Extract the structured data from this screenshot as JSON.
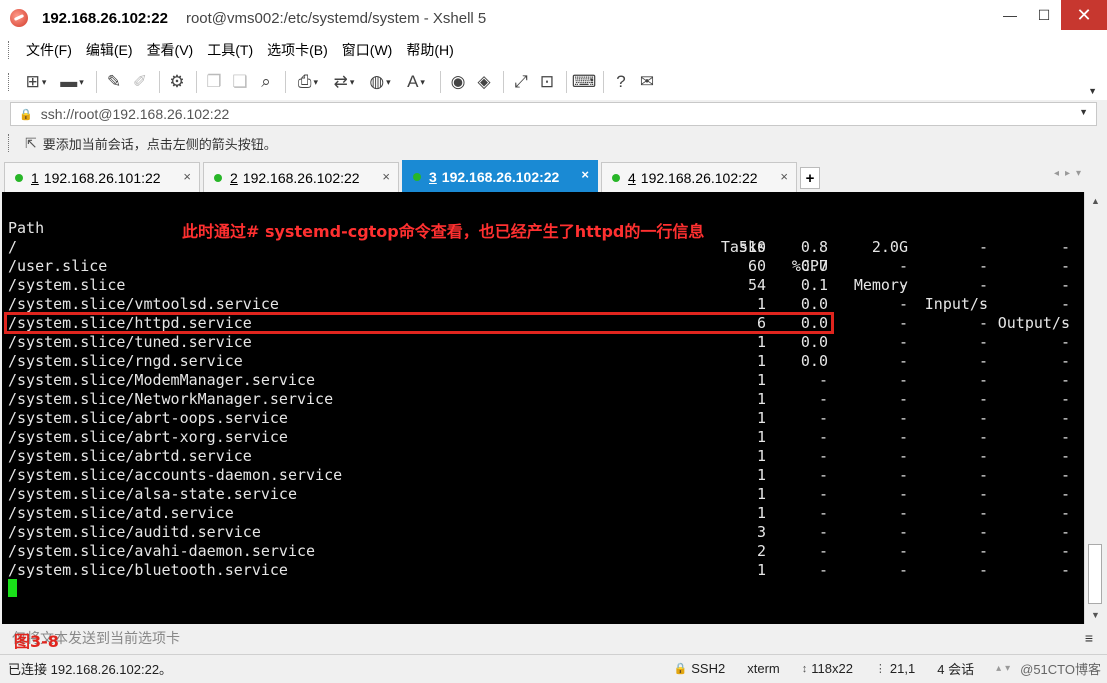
{
  "window": {
    "host_title": "192.168.26.102:22",
    "title_rest": "root@vms002:/etc/systemd/system - Xshell 5",
    "minimize_glyph": "—",
    "maximize_glyph": "☐",
    "close_glyph": "✕"
  },
  "menu": [
    "文件(F)",
    "编辑(E)",
    "查看(V)",
    "工具(T)",
    "选项卡(B)",
    "窗口(W)",
    "帮助(H)"
  ],
  "toolbar_icons": [
    "new-session-icon",
    "open-folder-icon",
    "edit-icon",
    "highlighter-icon",
    "properties-icon",
    "copy-icon",
    "paste-icon",
    "find-icon",
    "print-icon",
    "transfer-icon",
    "globe-icon",
    "font-icon",
    "xftp-icon",
    "xmanager-icon",
    "fullscreen-icon",
    "lock-icon",
    "keyboard-icon",
    "help-icon",
    "chat-icon"
  ],
  "address": {
    "value": "ssh://root@192.168.26.102:22"
  },
  "hint": {
    "text": "要添加当前会话，点击左侧的箭头按钮。"
  },
  "tabs": [
    {
      "num": "1",
      "label": "192.168.26.101:22",
      "active": false
    },
    {
      "num": "2",
      "label": "192.168.26.102:22",
      "active": false
    },
    {
      "num": "3",
      "label": "192.168.26.102:22",
      "active": true
    },
    {
      "num": "4",
      "label": "192.168.26.102:22",
      "active": false
    }
  ],
  "terminal": {
    "headers": {
      "path": "Path",
      "tasks": "Tasks",
      "cpu": "%CPU",
      "memory": "Memory",
      "input": "Input/s",
      "output": "Output/s"
    },
    "annotation": "此时通过# systemd-cgtop命令查看，也已经产生了httpd的一行信息",
    "rows": [
      {
        "path": "/",
        "tasks": "510",
        "cpu": "0.8",
        "memory": "2.0G",
        "input": "-",
        "output": "-"
      },
      {
        "path": "/user.slice",
        "tasks": "60",
        "cpu": "0.7",
        "memory": "-",
        "input": "-",
        "output": "-"
      },
      {
        "path": "/system.slice",
        "tasks": "54",
        "cpu": "0.1",
        "memory": "-",
        "input": "-",
        "output": "-"
      },
      {
        "path": "/system.slice/vmtoolsd.service",
        "tasks": "1",
        "cpu": "0.0",
        "memory": "-",
        "input": "-",
        "output": "-"
      },
      {
        "path": "/system.slice/httpd.service",
        "tasks": "6",
        "cpu": "0.0",
        "memory": "-",
        "input": "-",
        "output": "-"
      },
      {
        "path": "/system.slice/tuned.service",
        "tasks": "1",
        "cpu": "0.0",
        "memory": "-",
        "input": "-",
        "output": "-"
      },
      {
        "path": "/system.slice/rngd.service",
        "tasks": "1",
        "cpu": "0.0",
        "memory": "-",
        "input": "-",
        "output": "-"
      },
      {
        "path": "/system.slice/ModemManager.service",
        "tasks": "1",
        "cpu": "-",
        "memory": "-",
        "input": "-",
        "output": "-"
      },
      {
        "path": "/system.slice/NetworkManager.service",
        "tasks": "1",
        "cpu": "-",
        "memory": "-",
        "input": "-",
        "output": "-"
      },
      {
        "path": "/system.slice/abrt-oops.service",
        "tasks": "1",
        "cpu": "-",
        "memory": "-",
        "input": "-",
        "output": "-"
      },
      {
        "path": "/system.slice/abrt-xorg.service",
        "tasks": "1",
        "cpu": "-",
        "memory": "-",
        "input": "-",
        "output": "-"
      },
      {
        "path": "/system.slice/abrtd.service",
        "tasks": "1",
        "cpu": "-",
        "memory": "-",
        "input": "-",
        "output": "-"
      },
      {
        "path": "/system.slice/accounts-daemon.service",
        "tasks": "1",
        "cpu": "-",
        "memory": "-",
        "input": "-",
        "output": "-"
      },
      {
        "path": "/system.slice/alsa-state.service",
        "tasks": "1",
        "cpu": "-",
        "memory": "-",
        "input": "-",
        "output": "-"
      },
      {
        "path": "/system.slice/atd.service",
        "tasks": "1",
        "cpu": "-",
        "memory": "-",
        "input": "-",
        "output": "-"
      },
      {
        "path": "/system.slice/auditd.service",
        "tasks": "3",
        "cpu": "-",
        "memory": "-",
        "input": "-",
        "output": "-"
      },
      {
        "path": "/system.slice/avahi-daemon.service",
        "tasks": "2",
        "cpu": "-",
        "memory": "-",
        "input": "-",
        "output": "-"
      },
      {
        "path": "/system.slice/bluetooth.service",
        "tasks": "1",
        "cpu": "-",
        "memory": "-",
        "input": "-",
        "output": "-"
      }
    ]
  },
  "input_bar": {
    "placeholder": "仅将文本发送到当前选项卡",
    "figure_label": "图3-8"
  },
  "status": {
    "connection": "已连接 192.168.26.102:22。",
    "protocol": "SSH2",
    "terminal_type": "xterm",
    "size": "118x22",
    "cursor_pos": "21,1",
    "sessions": "4 会话",
    "watermark": "@51CTO博客"
  },
  "colors": {
    "active_tab": "#1a8ad4",
    "annotation": "#ff3030",
    "highlight_box": "#e0251e",
    "cursor": "#19e019",
    "connected_dot": "#28b628"
  }
}
